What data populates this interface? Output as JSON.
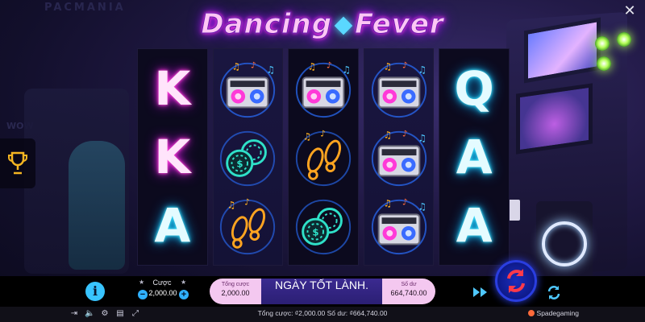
{
  "title": {
    "left": "Dancing",
    "right": "Fever"
  },
  "background": {
    "sign": "PACMANIA",
    "sign2": "WOW"
  },
  "reels": [
    [
      "K",
      "K",
      "A"
    ],
    [
      "boombox",
      "chips",
      "footsteps"
    ],
    [
      "boombox",
      "footsteps",
      "chips"
    ],
    [
      "boombox",
      "boombox",
      "boombox"
    ],
    [
      "Q",
      "A",
      "A"
    ]
  ],
  "bet": {
    "label": "Cược",
    "value": "2,000.00",
    "minus": "−",
    "plus": "+"
  },
  "message": {
    "stake_label": "Tổng cược",
    "stake_value": "2,000.00",
    "text": "NGÀY TỐT LÀNH.",
    "balance_label": "Số dư",
    "balance_value": "664,740.00"
  },
  "footer": {
    "text": "Tổng cược: ₫2,000.00  Số dư: ₫664,740.00",
    "provider": "Spadegaming"
  },
  "colors": {
    "pink": "#ff4fd8",
    "cyan": "#4fe6ff",
    "gold": "#ffb020",
    "spin": "#1a2dbd"
  }
}
